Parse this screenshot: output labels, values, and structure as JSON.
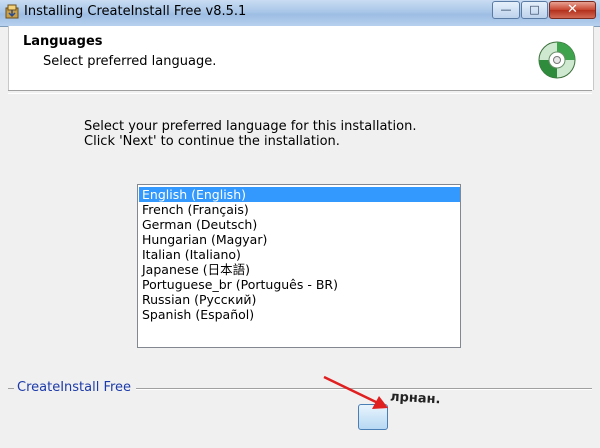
{
  "window": {
    "title": "Installing CreateInstall Free v8.5.1",
    "min_glyph": "—",
    "max_glyph": "□",
    "close_glyph": "✕"
  },
  "header": {
    "title": "Languages",
    "subtitle": "Select preferred language."
  },
  "instructions": {
    "line1": "Select your preferred language for this installation.",
    "line2": "Click 'Next' to continue the installation."
  },
  "languages": {
    "selected_index": 0,
    "items": [
      "English (English)",
      "French (Français)",
      "German (Deutsch)",
      "Hungarian (Magyar)",
      "Italian (Italiano)",
      "Japanese (日本語)",
      "Portuguese_br (Português - BR)",
      "Russian (Русский)",
      "Spanish (Español)"
    ]
  },
  "footer": {
    "brand": "CreateInstall Free",
    "obscured_text": "лрнан."
  },
  "colors": {
    "selection": "#3399ff",
    "brand_text": "#1c3aa9",
    "annotation_arrow": "#e02020"
  }
}
